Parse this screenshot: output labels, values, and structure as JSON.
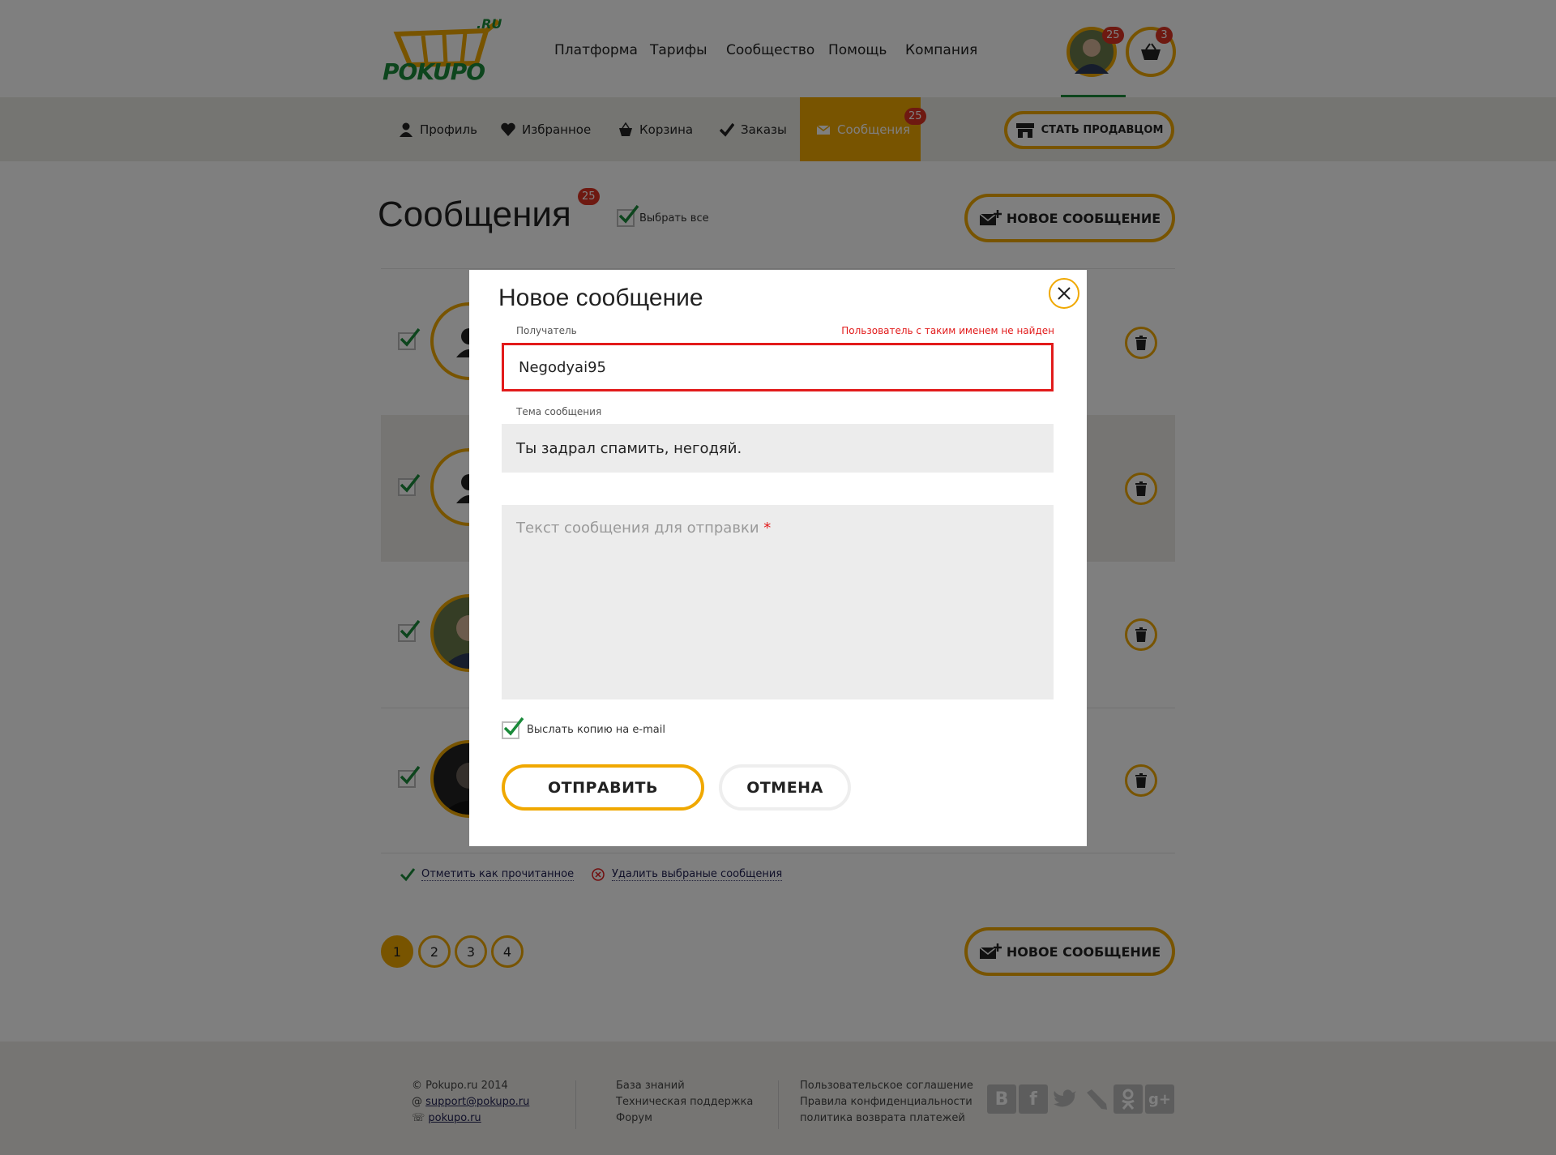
{
  "header": {
    "logo_text": "POKUPO",
    "logo_tld": ".RU",
    "nav": [
      "Платформа",
      "Тарифы",
      "Сообщество",
      "Помощь",
      "Компания"
    ],
    "avatar_badge": "25",
    "cart_badge": "3"
  },
  "tabs": {
    "items": [
      {
        "label": "Профиль",
        "icon": "user-icon"
      },
      {
        "label": "Избранное",
        "icon": "heart-icon"
      },
      {
        "label": "Корзина",
        "icon": "basket-icon"
      },
      {
        "label": "Заказы",
        "icon": "check-icon"
      },
      {
        "label": "Сообщения",
        "icon": "envelope-icon",
        "badge": "25",
        "active": true
      }
    ],
    "seller_button": "СТАТЬ ПРОДАВЦОМ"
  },
  "main": {
    "title": "Сообщения",
    "title_badge": "25",
    "select_all": "Выбрать все",
    "new_message": "НОВОЕ СООБЩЕНИЕ",
    "mark_read": "Отметить как прочитанное",
    "delete_selected": "Удалить выбраные сообщения",
    "pages": [
      "1",
      "2",
      "3",
      "4"
    ],
    "current_page": "1"
  },
  "footer": {
    "col1": [
      "Pokupo.ru 2014",
      "support@pokupo.ru",
      "pokupo.ru"
    ],
    "col2": [
      "База знаний",
      "Техническая поддержка",
      "Форум"
    ],
    "col3": [
      "Пользовательское соглашение",
      "Правила конфиденциальности",
      "политика возврата платежей"
    ],
    "social": [
      "В",
      "f",
      "twitter-icon",
      "livejournal-icon",
      "ok-icon",
      "g+"
    ]
  },
  "modal": {
    "title": "Новое сообщение",
    "recipient_label": "Получатель",
    "recipient_error": "Пользователь с таким именем не найден",
    "recipient_value": "Negodyai95",
    "subject_label": "Тема сообщения",
    "subject_value": "Ты задрал спамить, негодяй.",
    "body_placeholder": "Текст сообщения для отправки",
    "body_required_mark": "*",
    "email_copy_label": "Выслать копию на e-mail",
    "send_button": "ОТПРАВИТЬ",
    "cancel_button": "ОТМЕНА"
  },
  "colors": {
    "accent": "#f0a800",
    "error": "#e21b1b",
    "check": "#1a8a3a",
    "badge": "#d33322"
  }
}
